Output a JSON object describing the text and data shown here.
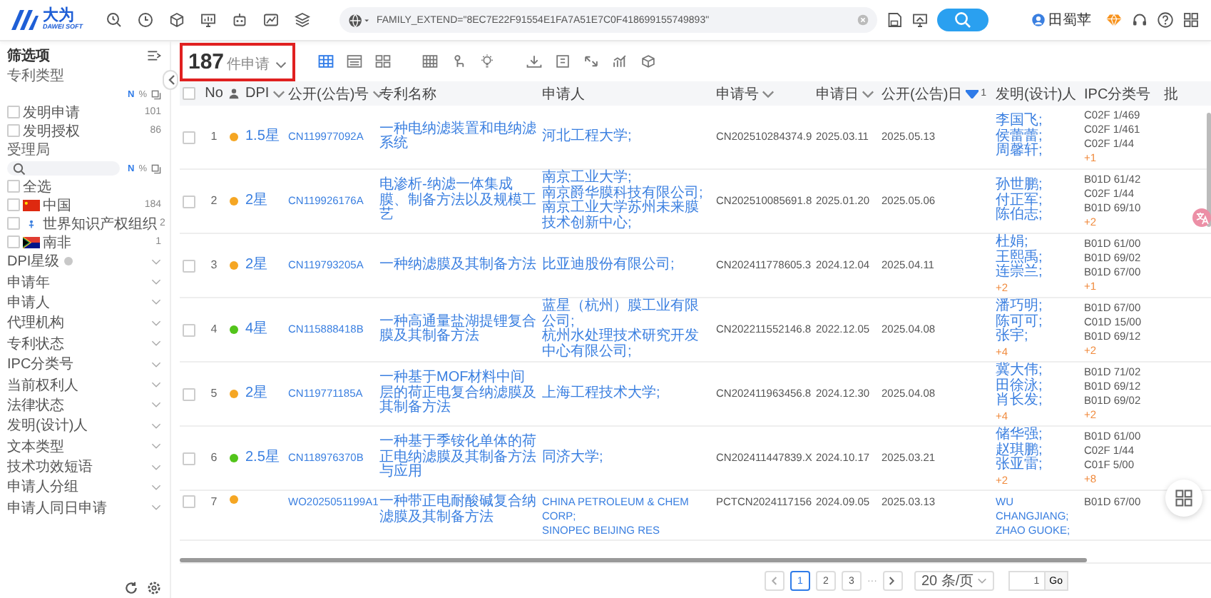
{
  "logo": {
    "mark": "大为",
    "subtitle": "DAWEI SOFT"
  },
  "search": {
    "value": "FAMILY_EXTEND=\"8EC7E22F91554E1FA7A51E7C0F418699155749893\""
  },
  "user": {
    "name": "田蜀苹"
  },
  "sidebar": {
    "title": "筛选项",
    "sections": [
      {
        "title": "专利类型",
        "kind": "list",
        "tools": [
          "N",
          "%"
        ],
        "options": [
          {
            "label": "发明申请",
            "count": "101",
            "checked": false
          },
          {
            "label": "发明授权",
            "count": "86",
            "checked": false
          }
        ]
      },
      {
        "title": "受理局",
        "kind": "search-list",
        "tools": [
          "N",
          "%"
        ],
        "options": [
          {
            "label": "全选",
            "checked": false
          },
          {
            "label": "中国",
            "count": "184",
            "checked": false
          },
          {
            "label": "世界知识产权组织",
            "count": "2",
            "checked": false
          },
          {
            "label": "南非",
            "count": "1",
            "checked": false
          }
        ]
      }
    ],
    "filters": [
      {
        "label": "DPI星级",
        "info": true
      },
      {
        "label": "申请年",
        "info": false
      },
      {
        "label": "申请人",
        "info": false
      },
      {
        "label": "代理机构",
        "info": false
      },
      {
        "label": "专利状态",
        "info": false
      },
      {
        "label": "IPC分类号",
        "info": false
      },
      {
        "label": "当前权利人",
        "info": false
      },
      {
        "label": "法律状态",
        "info": false
      },
      {
        "label": "发明(设计)人",
        "info": false
      },
      {
        "label": "文本类型",
        "info": false
      },
      {
        "label": "技术功效短语",
        "info": false
      },
      {
        "label": "申请人分组",
        "info": false
      },
      {
        "label": "申请人同日申请",
        "info": false
      }
    ]
  },
  "results": {
    "count": "187",
    "unit": "件申请"
  },
  "table": {
    "columns": [
      {
        "kind": "check",
        "checked": false
      },
      {
        "kind": "text",
        "label": "No"
      },
      {
        "kind": "icon"
      },
      {
        "kind": "text",
        "label": "DPI",
        "sorted": false
      },
      {
        "kind": "text",
        "label": "公开(公告)号",
        "sorted": false
      },
      {
        "kind": "text",
        "label": "专利名称"
      },
      {
        "kind": "text",
        "label": "申请人"
      },
      {
        "kind": "text",
        "label": "申请号",
        "sorted": false
      },
      {
        "kind": "text",
        "label": "申请日",
        "sorted": false
      },
      {
        "kind": "text",
        "label": "公开(公告)日",
        "sorted": true,
        "sort_order": "1"
      },
      {
        "kind": "text",
        "label": "发明(设计)人"
      },
      {
        "kind": "text",
        "label": "IPC分类号"
      },
      {
        "kind": "text",
        "label": "批"
      }
    ],
    "rows": [
      {
        "checked": false,
        "no": "1",
        "color": "#f5a623",
        "dpi": "1.5星",
        "pub_no": "CN119977092A",
        "title": "一种电纳滤装置和电纳滤系统",
        "applicants": [
          "河北工程大学;"
        ],
        "app_no": "CN202510284374.9",
        "app_date": "2025.03.11",
        "pub_date": "2025.05.13",
        "inventors": [
          "李国飞;",
          "侯蕾蕾;",
          "周馨轩;"
        ],
        "ipc": [
          "C02F 1/469",
          "C02F 1/461",
          "C02F 1/44"
        ],
        "ipc_more": "+1"
      },
      {
        "checked": false,
        "no": "2",
        "color": "#f5a623",
        "dpi": "2星",
        "pub_no": "CN119926176A",
        "title": "电渗析-纳滤一体集成膜、制备方法以及规模工艺",
        "applicants": [
          "南京工业大学;",
          "南京爵华膜科技有限公司;",
          "南京工业大学苏州未来膜技术创新中心;"
        ],
        "app_no": "CN202510085691.8",
        "app_date": "2025.01.20",
        "pub_date": "2025.05.06",
        "inventors": [
          "孙世鹏;",
          "付正军;",
          "陈伯志;"
        ],
        "ipc": [
          "B01D 61/42",
          "C02F 1/44",
          "B01D 69/10"
        ],
        "ipc_more": "+2"
      },
      {
        "checked": false,
        "no": "3",
        "color": "#f5a623",
        "dpi": "2星",
        "pub_no": "CN119793205A",
        "title": "一种纳滤膜及其制备方法",
        "applicants": [
          "比亚迪股份有限公司;"
        ],
        "app_no": "CN202411778605.3",
        "app_date": "2024.12.04",
        "pub_date": "2025.04.11",
        "inventors": [
          "杜娟;",
          "王熙禹;",
          "连崇兰;"
        ],
        "inventors_more": "+2",
        "ipc": [
          "B01D 61/00",
          "B01D 69/02",
          "B01D 67/00"
        ],
        "ipc_more": "+1"
      },
      {
        "checked": false,
        "no": "4",
        "color": "#52c41a",
        "dpi": "4星",
        "pub_no": "CN115888418B",
        "title": "一种高通量盐湖提锂复合膜及其制备方法",
        "applicants": [
          "蓝星（杭州）膜工业有限公司;",
          "杭州水处理技术研究开发中心有限公司;"
        ],
        "app_no": "CN202211552146.8",
        "app_date": "2022.12.05",
        "pub_date": "2025.04.08",
        "inventors": [
          "潘巧明;",
          "陈可可;",
          "张宇;"
        ],
        "inventors_more": "+4",
        "ipc": [
          "B01D 67/00",
          "C01D 15/00",
          "B01D 69/12"
        ],
        "ipc_more": "+2"
      },
      {
        "checked": false,
        "no": "5",
        "color": "#f5a623",
        "dpi": "2星",
        "pub_no": "CN119771185A",
        "title": "一种基于MOF材料中间层的荷正电复合纳滤膜及其制备方法",
        "applicants": [
          "上海工程技术大学;"
        ],
        "app_no": "CN202411963456.8",
        "app_date": "2024.12.30",
        "pub_date": "2025.04.08",
        "inventors": [
          "冀大伟;",
          "田徐泳;",
          "肖长发;"
        ],
        "inventors_more": "+4",
        "ipc": [
          "B01D 71/02",
          "B01D 69/12",
          "B01D 69/02"
        ],
        "ipc_more": "+2"
      },
      {
        "checked": false,
        "no": "6",
        "color": "#52c41a",
        "dpi": "2.5星",
        "pub_no": "CN118976370B",
        "title": "一种基于季铵化单体的荷正电纳滤膜及其制备方法与应用",
        "applicants": [
          "同济大学;"
        ],
        "app_no": "CN202411447839.X",
        "app_date": "2024.10.17",
        "pub_date": "2025.03.21",
        "inventors": [
          "储华强;",
          "赵琪鹏;",
          "张亚雷;"
        ],
        "inventors_more": "+2",
        "ipc": [
          "B01D 61/00",
          "C02F 1/44",
          "C01F 5/00"
        ],
        "ipc_more": "+8"
      },
      {
        "checked": false,
        "no": "7",
        "color": "#f5a623",
        "pub_no": "WO2025051199A1",
        "title": "一种带正电耐酸碱复合纳滤膜及其制备方法",
        "applicants": [
          "CHINA PETROLEUM & CHEM CORP;",
          "SINOPEC BEIJING RES"
        ],
        "app_no": "PCTCN2024117156",
        "app_date": "2024.09.05",
        "pub_date": "2025.03.13",
        "inventors": [
          "WU CHANGJIANG;",
          "ZHAO GUOKE;"
        ],
        "ipc": [
          "B01D 67/00"
        ]
      }
    ]
  },
  "pagination": {
    "pages": [
      {
        "label": "1",
        "selected": true
      },
      {
        "label": "2",
        "selected": false
      },
      {
        "label": "3",
        "selected": false
      }
    ],
    "ellipsis": "···",
    "page_size": "20 条/页",
    "goto_value": "1",
    "go_label": "Go"
  }
}
